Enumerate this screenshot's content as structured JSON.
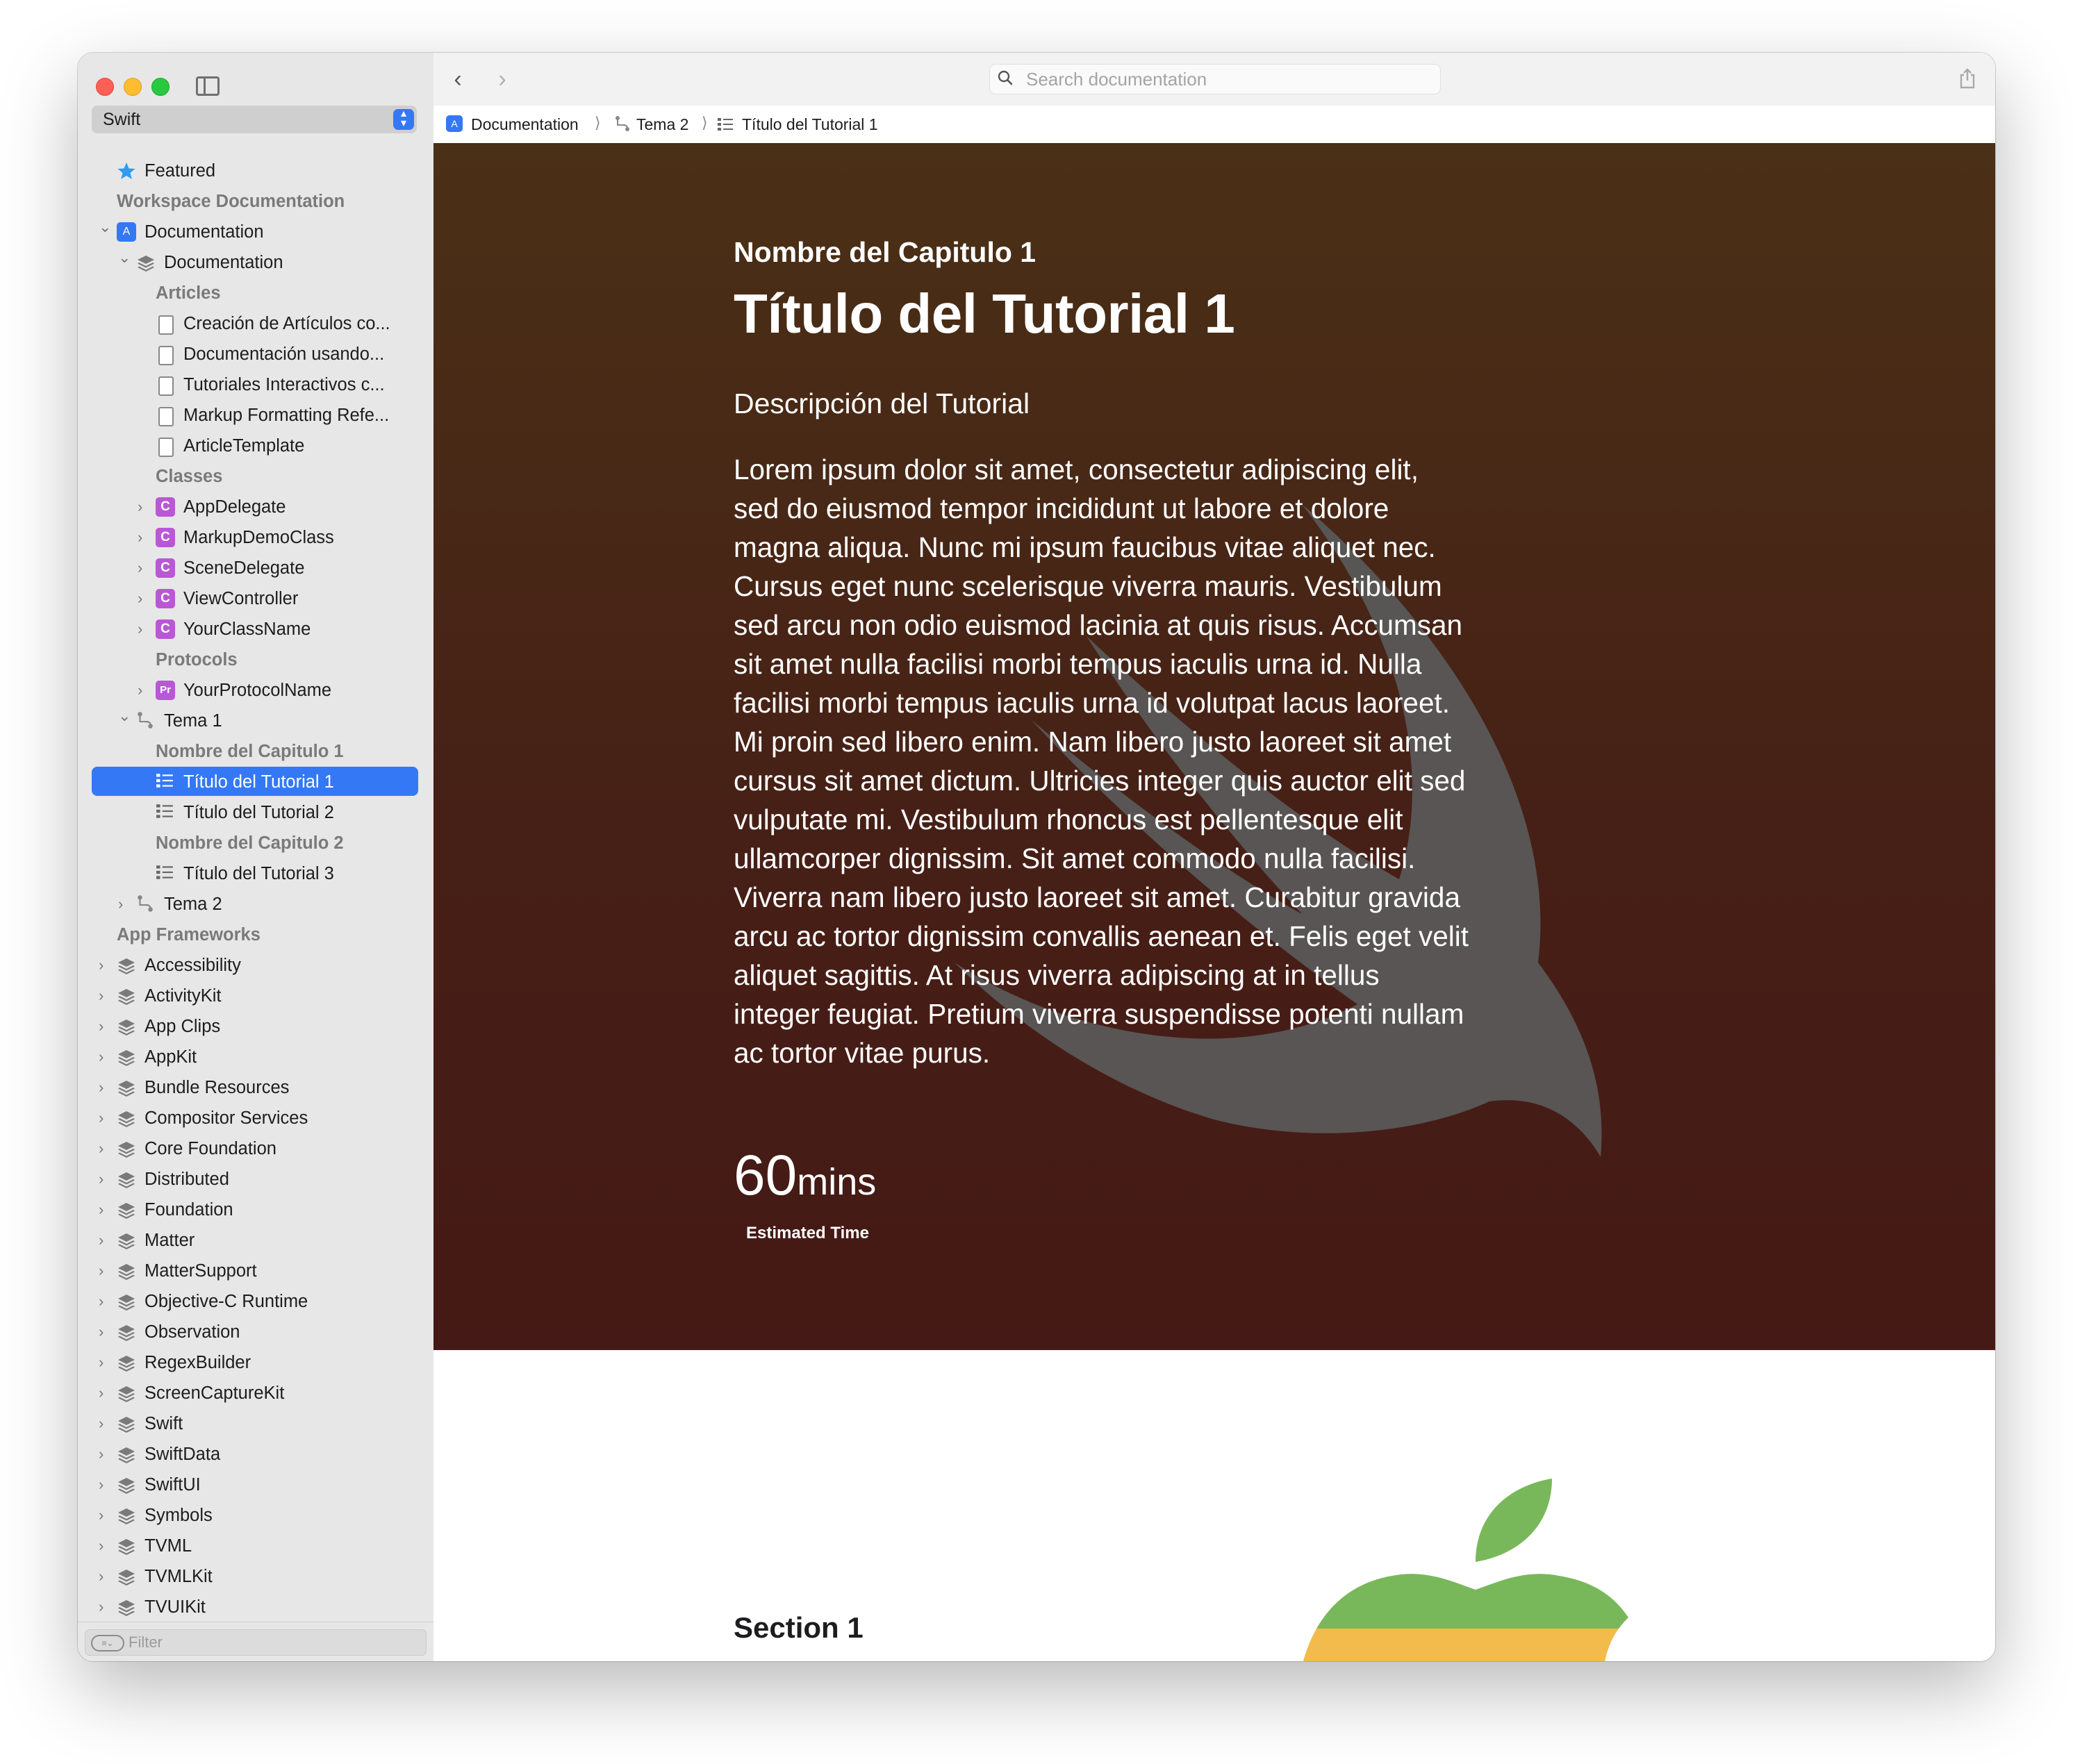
{
  "sidebar": {
    "language": "Swift",
    "filter_placeholder": "Filter",
    "items": [
      {
        "label": "Featured",
        "kind": "star",
        "level": 0,
        "type": "item"
      },
      {
        "label": "Workspace Documentation",
        "kind": "header",
        "level": 0,
        "type": "header"
      },
      {
        "label": "Documentation",
        "kind": "app",
        "level": 0,
        "type": "item",
        "chevron": "down"
      },
      {
        "label": "Documentation",
        "kind": "stack",
        "level": 1,
        "type": "item",
        "chevron": "down"
      },
      {
        "label": "Articles",
        "kind": "header",
        "level": 2,
        "type": "header"
      },
      {
        "label": "Creación de Artículos co...",
        "kind": "doc",
        "level": 2,
        "type": "item"
      },
      {
        "label": "Documentación usando...",
        "kind": "doc",
        "level": 2,
        "type": "item"
      },
      {
        "label": "Tutoriales Interactivos c...",
        "kind": "doc",
        "level": 2,
        "type": "item"
      },
      {
        "label": "Markup Formatting Refe...",
        "kind": "doc",
        "level": 2,
        "type": "item"
      },
      {
        "label": "ArticleTemplate",
        "kind": "doc",
        "level": 2,
        "type": "item"
      },
      {
        "label": "Classes",
        "kind": "header",
        "level": 2,
        "type": "header"
      },
      {
        "label": "AppDelegate",
        "kind": "class",
        "level": 2,
        "type": "item",
        "chevron": "right"
      },
      {
        "label": "MarkupDemoClass",
        "kind": "class",
        "level": 2,
        "type": "item",
        "chevron": "right"
      },
      {
        "label": "SceneDelegate",
        "kind": "class",
        "level": 2,
        "type": "item",
        "chevron": "right"
      },
      {
        "label": "ViewController",
        "kind": "class",
        "level": 2,
        "type": "item",
        "chevron": "right"
      },
      {
        "label": "YourClassName",
        "kind": "class",
        "level": 2,
        "type": "item",
        "chevron": "right"
      },
      {
        "label": "Protocols",
        "kind": "header",
        "level": 2,
        "type": "header"
      },
      {
        "label": "YourProtocolName",
        "kind": "protocol",
        "level": 2,
        "type": "item",
        "chevron": "right"
      },
      {
        "label": "Tema 1",
        "kind": "topic",
        "level": 1,
        "type": "item",
        "chevron": "down"
      },
      {
        "label": "Nombre del Capitulo 1",
        "kind": "header",
        "level": 2,
        "type": "header"
      },
      {
        "label": "Título del Tutorial 1",
        "kind": "tutorial",
        "level": 2,
        "type": "item",
        "selected": true
      },
      {
        "label": "Título del Tutorial 2",
        "kind": "tutorial",
        "level": 2,
        "type": "item"
      },
      {
        "label": "Nombre del Capitulo 2",
        "kind": "header",
        "level": 2,
        "type": "header"
      },
      {
        "label": "Título del Tutorial 3",
        "kind": "tutorial",
        "level": 2,
        "type": "item"
      },
      {
        "label": "Tema 2",
        "kind": "topic",
        "level": 1,
        "type": "item",
        "chevron": "right"
      },
      {
        "label": "App Frameworks",
        "kind": "header",
        "level": 0,
        "type": "header"
      },
      {
        "label": "Accessibility",
        "kind": "stack",
        "level": 0,
        "type": "item",
        "chevron": "right"
      },
      {
        "label": "ActivityKit",
        "kind": "stack",
        "level": 0,
        "type": "item",
        "chevron": "right"
      },
      {
        "label": "App Clips",
        "kind": "stack",
        "level": 0,
        "type": "item",
        "chevron": "right"
      },
      {
        "label": "AppKit",
        "kind": "stack",
        "level": 0,
        "type": "item",
        "chevron": "right"
      },
      {
        "label": "Bundle Resources",
        "kind": "stack",
        "level": 0,
        "type": "item",
        "chevron": "right"
      },
      {
        "label": "Compositor Services",
        "kind": "stack",
        "level": 0,
        "type": "item",
        "chevron": "right"
      },
      {
        "label": "Core Foundation",
        "kind": "stack",
        "level": 0,
        "type": "item",
        "chevron": "right"
      },
      {
        "label": "Distributed",
        "kind": "stack",
        "level": 0,
        "type": "item",
        "chevron": "right"
      },
      {
        "label": "Foundation",
        "kind": "stack",
        "level": 0,
        "type": "item",
        "chevron": "right"
      },
      {
        "label": "Matter",
        "kind": "stack",
        "level": 0,
        "type": "item",
        "chevron": "right"
      },
      {
        "label": "MatterSupport",
        "kind": "stack",
        "level": 0,
        "type": "item",
        "chevron": "right"
      },
      {
        "label": "Objective-C Runtime",
        "kind": "stack",
        "level": 0,
        "type": "item",
        "chevron": "right"
      },
      {
        "label": "Observation",
        "kind": "stack",
        "level": 0,
        "type": "item",
        "chevron": "right"
      },
      {
        "label": "RegexBuilder",
        "kind": "stack",
        "level": 0,
        "type": "item",
        "chevron": "right"
      },
      {
        "label": "ScreenCaptureKit",
        "kind": "stack",
        "level": 0,
        "type": "item",
        "chevron": "right"
      },
      {
        "label": "Swift",
        "kind": "stack",
        "level": 0,
        "type": "item",
        "chevron": "right"
      },
      {
        "label": "SwiftData",
        "kind": "stack",
        "level": 0,
        "type": "item",
        "chevron": "right"
      },
      {
        "label": "SwiftUI",
        "kind": "stack",
        "level": 0,
        "type": "item",
        "chevron": "right"
      },
      {
        "label": "Symbols",
        "kind": "stack",
        "level": 0,
        "type": "item",
        "chevron": "right"
      },
      {
        "label": "TVML",
        "kind": "stack",
        "level": 0,
        "type": "item",
        "chevron": "right"
      },
      {
        "label": "TVMLKit",
        "kind": "stack",
        "level": 0,
        "type": "item",
        "chevron": "right"
      },
      {
        "label": "TVUIKit",
        "kind": "stack",
        "level": 0,
        "type": "item",
        "chevron": "right"
      }
    ]
  },
  "toolbar": {
    "search_placeholder": "Search documentation"
  },
  "breadcrumb": {
    "items": [
      {
        "label": "Documentation",
        "icon": "app-icon"
      },
      {
        "label": "Tema 2",
        "icon": "topic-icon"
      },
      {
        "label": "Título del Tutorial 1",
        "icon": "tutorial-icon"
      }
    ]
  },
  "hero": {
    "chapter": "Nombre del Capitulo 1",
    "title": "Título del Tutorial 1",
    "subtitle": "Descripción del Tutorial",
    "description": "Lorem ipsum dolor sit amet, consectetur adipiscing elit, sed do eiusmod tempor incididunt ut labore et dolore magna aliqua. Nunc mi ipsum faucibus vitae aliquet nec. Cursus eget nunc scelerisque viverra mauris. Vestibulum sed arcu non odio euismod lacinia at quis risus. Accumsan sit amet nulla facilisi morbi tempus iaculis urna id. Nulla facilisi morbi tempus iaculis urna id volutpat lacus laoreet. Mi proin sed libero enim. Nam libero justo laoreet sit amet cursus sit amet dictum. Ultricies integer quis auctor elit sed vulputate mi. Vestibulum rhoncus est pellentesque elit ullamcorper dignissim. Sit amet commodo nulla facilisi. Viverra nam libero justo laoreet sit amet. Curabitur gravida arcu ac tortor dignissim convallis aenean et. Felis eget velit aliquet sagittis. At risus viverra adipiscing at in tellus integer feugiat. Pretium viverra suspendisse potenti nullam ac tortor vitae purus.",
    "time_value": "60",
    "time_unit": "mins",
    "time_label": "Estimated Time"
  },
  "section": {
    "title": "Section 1"
  },
  "colors": {
    "accent": "#3478f6",
    "hero_top": "#4a3016",
    "hero_bottom": "#451915",
    "class_badge": "#b957d6"
  }
}
